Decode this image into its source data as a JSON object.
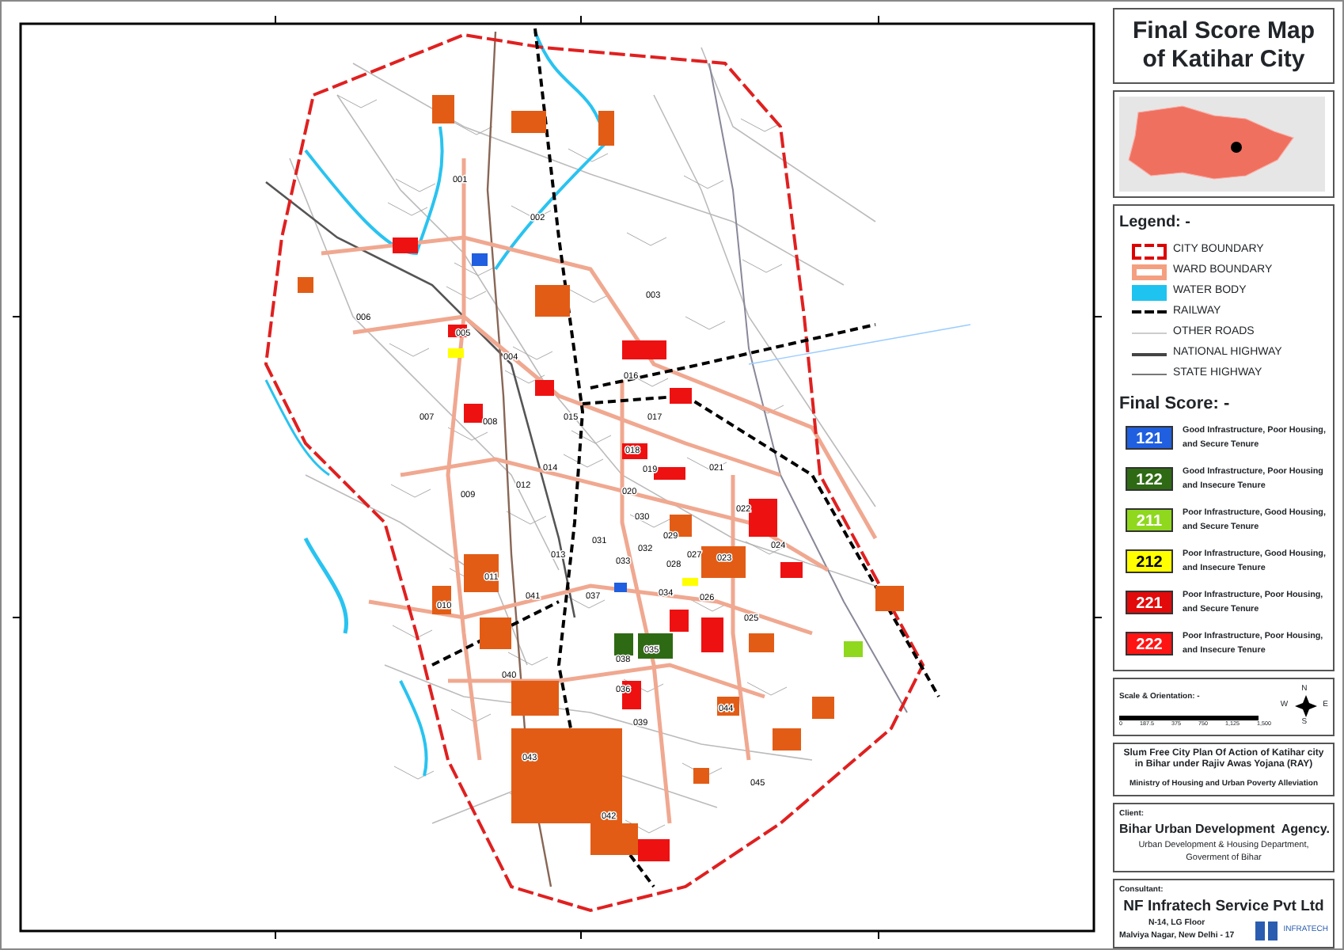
{
  "map": {
    "wards": [
      {
        "label": "001"
      },
      {
        "label": "002"
      },
      {
        "label": "003"
      },
      {
        "label": "004"
      },
      {
        "label": "005"
      },
      {
        "label": "006"
      },
      {
        "label": "007"
      },
      {
        "label": "008"
      },
      {
        "label": "009"
      },
      {
        "label": "010"
      },
      {
        "label": "011"
      },
      {
        "label": "012"
      },
      {
        "label": "013"
      },
      {
        "label": "014"
      },
      {
        "label": "015"
      },
      {
        "label": "016"
      },
      {
        "label": "017"
      },
      {
        "label": "018"
      },
      {
        "label": "019"
      },
      {
        "label": "020"
      },
      {
        "label": "021"
      },
      {
        "label": "022"
      },
      {
        "label": "023"
      },
      {
        "label": "024"
      },
      {
        "label": "025"
      },
      {
        "label": "026"
      },
      {
        "label": "027"
      },
      {
        "label": "028"
      },
      {
        "label": "029"
      },
      {
        "label": "030"
      },
      {
        "label": "031"
      },
      {
        "label": "032"
      },
      {
        "label": "033"
      },
      {
        "label": "034"
      },
      {
        "label": "035"
      },
      {
        "label": "036"
      },
      {
        "label": "037"
      },
      {
        "label": "038"
      },
      {
        "label": "039"
      },
      {
        "label": "040"
      },
      {
        "label": "041"
      },
      {
        "label": "042"
      },
      {
        "label": "043"
      },
      {
        "label": "044"
      },
      {
        "label": "045"
      }
    ]
  },
  "title": {
    "lines": [
      "Final Score Map",
      "of  Katihar City"
    ]
  },
  "legend": {
    "heading": "Legend: -",
    "items": [
      {
        "kind": "city_boundary",
        "label": "CITY BOUNDARY"
      },
      {
        "kind": "ward_boundary",
        "label": "WARD BOUNDARY"
      },
      {
        "kind": "water_body",
        "label": "WATER BODY"
      },
      {
        "kind": "railway",
        "label": "RAILWAY"
      },
      {
        "kind": "other_roads",
        "label": "OTHER ROADS"
      },
      {
        "kind": "national_highway",
        "label": "NATIONAL HIGHWAY"
      },
      {
        "kind": "state_highway",
        "label": "STATE HIGHWAY"
      }
    ]
  },
  "final_score": {
    "heading": "Final Score: -",
    "items": [
      {
        "code": "121",
        "color": "#1f5fe0",
        "description": "Good Infrastructure, Poor Housing, and Secure Tenure"
      },
      {
        "code": "122",
        "color": "#2e6a14",
        "description": "Good Infrastructure, Poor Housing and Insecure Tenure"
      },
      {
        "code": "211",
        "color": "#8fd81e",
        "description": "Poor Infrastructure, Good Housing, and Secure Tenure"
      },
      {
        "code": "212",
        "color": "#ffff00",
        "description": "Poor Infrastructure, Good Housing, and Insecure Tenure"
      },
      {
        "code": "221",
        "color": "#e20a0a",
        "description": "Poor Infrastructure, Poor Housing, and Secure Tenure"
      },
      {
        "code": "222",
        "color": "#ff1414",
        "description": "Poor Infrastructure, Poor Housing, and Insecure Tenure"
      }
    ]
  },
  "scale": {
    "heading": "Scale & Orientation: -",
    "ticks": [
      "0",
      "187.5",
      "375",
      "750",
      "1,125",
      "1,500"
    ],
    "compass": {
      "north": "N",
      "east": "E",
      "south": "S",
      "west": "W"
    }
  },
  "project": {
    "title": "Slum Free City Plan Of Action of Katihar city in Bihar under Rajiv Awas Yojana (RAY)",
    "ministry": "Ministry of Housing and Urban Poverty Alleviation"
  },
  "client": {
    "heading": "Client:",
    "name": "Bihar Urban Development  Agency.",
    "department": "Urban Development & Housing Department, Goverment of Bihar"
  },
  "consultant": {
    "heading": "Consultant:",
    "name": "NF Infratech Service Pvt Ltd",
    "address": [
      "N-14, LG Floor",
      "Malviya Nagar, New Delhi - 17"
    ],
    "logo_text": "INFRATECH"
  }
}
